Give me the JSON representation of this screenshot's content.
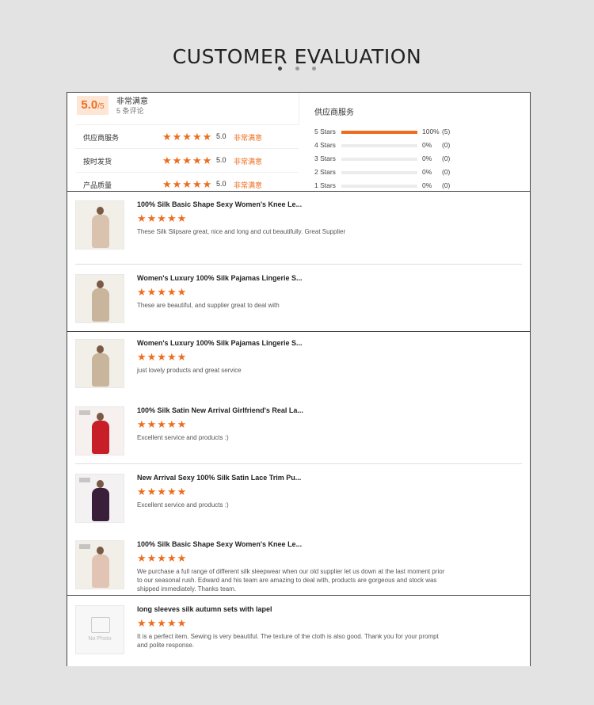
{
  "page": {
    "title": "CUSTOMER EVALUATION"
  },
  "summary": {
    "score": "5.0",
    "score_max": "/5",
    "satisfaction": "非常满意",
    "review_count": "5 条评论",
    "ratings": [
      {
        "label": "供应商服务",
        "value": "5.0",
        "text": "非常满意",
        "stars": 5
      },
      {
        "label": "按时发货",
        "value": "5.0",
        "text": "非常满意",
        "stars": 5
      },
      {
        "label": "产品质量",
        "value": "5.0",
        "text": "非常满意",
        "stars": 5
      }
    ],
    "supplier_title": "供应商服务",
    "distribution": [
      {
        "label": "5 Stars",
        "percent": "100%",
        "count": "(5)",
        "fill": 1.0
      },
      {
        "label": "4 Stars",
        "percent": "0%",
        "count": "(0)",
        "fill": 0
      },
      {
        "label": "3 Stars",
        "percent": "0%",
        "count": "(0)",
        "fill": 0
      },
      {
        "label": "2 Stars",
        "percent": "0%",
        "count": "(0)",
        "fill": 0
      },
      {
        "label": "1 Stars",
        "percent": "0%",
        "count": "(0)",
        "fill": 0
      }
    ]
  },
  "reviews": [
    {
      "title": "100% Silk Basic Shape Sexy Women's Knee Le...",
      "stars": 5,
      "comment": "These Silk Slipsare great, nice and long and cut beautifully. Great Supplier"
    },
    {
      "title": "Women's Luxury 100% Silk Pajamas Lingerie S...",
      "stars": 5,
      "comment": "These are beautiful, and supplier great to deal with"
    },
    {
      "title": "Women's Luxury 100% Silk Pajamas Lingerie S...",
      "stars": 5,
      "comment": "just lovely products and great service"
    },
    {
      "title": "100% Silk Satin New Arrival Girlfriend's Real La...",
      "stars": 5,
      "comment": "Excellent service and products :)"
    },
    {
      "title": "New Arrival Sexy 100% Silk Satin Lace Trim Pu...",
      "stars": 5,
      "comment": "Excellent service and products :)"
    },
    {
      "title": "100% Silk Basic Shape Sexy Women's Knee Le...",
      "stars": 5,
      "comment": "We purchase a full range of different silk sleepwear when our old supplier let us down at the last moment prior to our seasonal rush. Edward and his team are amazing to deal with, products are gorgeous and stock was shipped immediately. Thanks team."
    },
    {
      "title": "long sleeves silk autumn sets with lapel",
      "stars": 5,
      "comment": "It is a perfect item. Sewing is very beautiful. The texture of the cloth is also good. Thank you for your prompt and polite response."
    }
  ],
  "no_photo_label": "No Photo",
  "star_glyph": "★★★★★",
  "colors": {
    "accent": "#ed6d1f"
  },
  "icons": {
    "star": "star-icon",
    "no_photo": "image-placeholder-icon"
  }
}
